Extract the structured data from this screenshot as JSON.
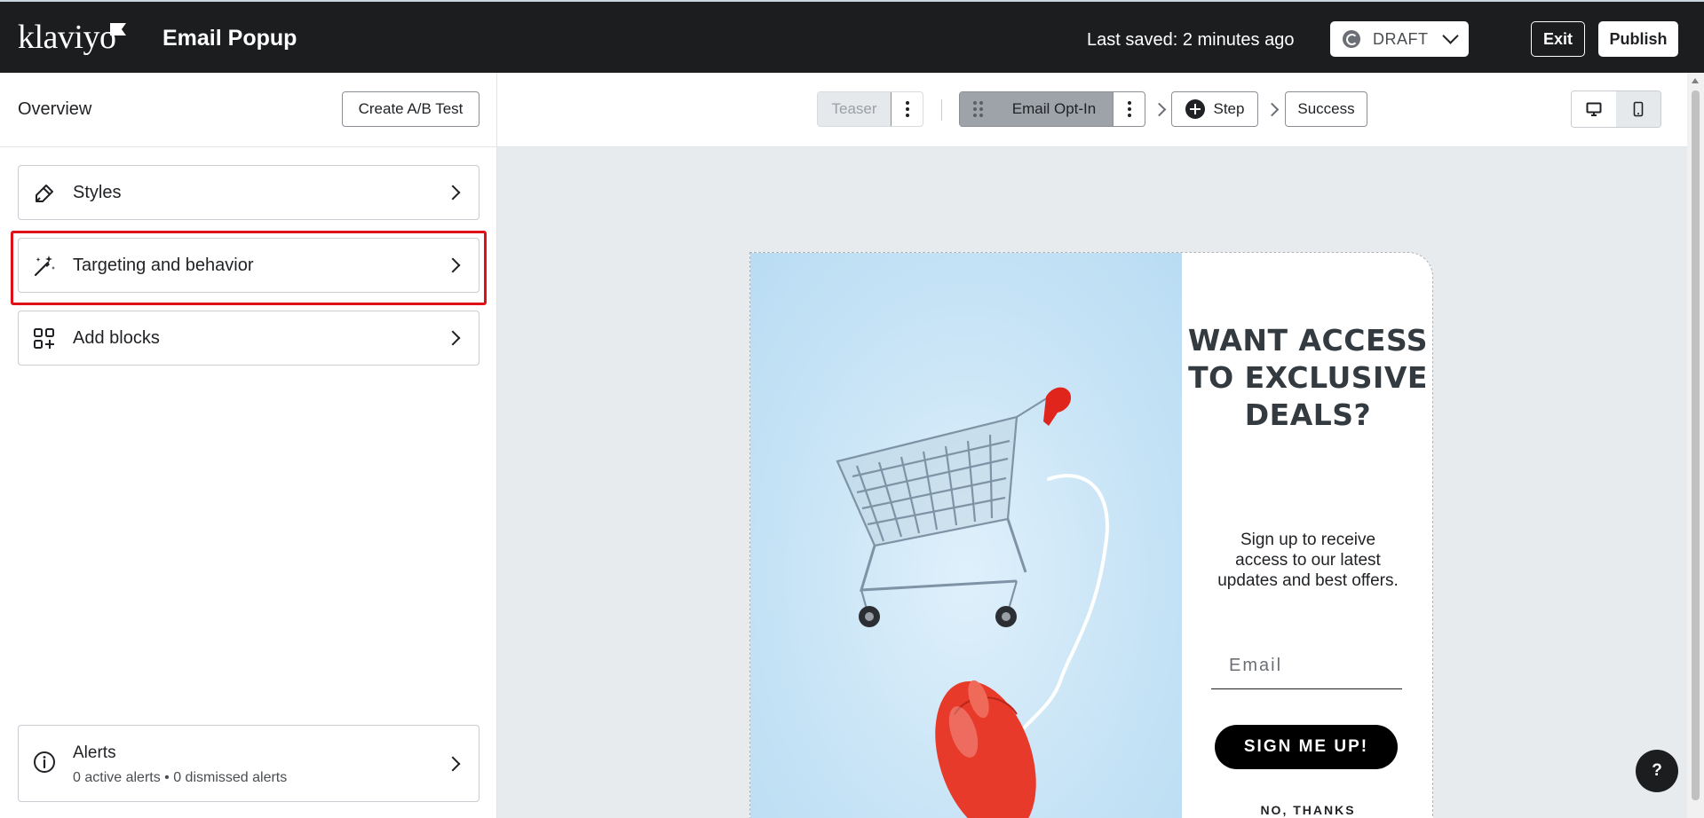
{
  "header": {
    "logo_text": "klaviyo",
    "title": "Email Popup",
    "last_saved": "Last saved: 2 minutes ago",
    "status_select": "DRAFT",
    "exit_label": "Exit",
    "publish_label": "Publish"
  },
  "sidebar": {
    "title": "Overview",
    "ab_test_label": "Create A/B Test",
    "items": [
      {
        "label": "Styles",
        "icon": "paintbrush-icon"
      },
      {
        "label": "Targeting and behavior",
        "icon": "magic-wand-icon",
        "highlighted": true
      },
      {
        "label": "Add blocks",
        "icon": "add-blocks-icon"
      }
    ],
    "alerts": {
      "title": "Alerts",
      "subtitle": "0 active alerts • 0 dismissed alerts"
    }
  },
  "steps": {
    "teaser": "Teaser",
    "optin": "Email Opt-In",
    "add_step": "Step",
    "success": "Success"
  },
  "popup": {
    "headline": "WANT ACCESS TO EXCLUSIVE DEALS?",
    "subtext": "Sign up to receive access to our latest updates and best offers.",
    "email_placeholder": "Email",
    "signup_label": "SIGN ME UP!",
    "no_thanks_label": "NO, THANKS"
  },
  "help_label": "?",
  "colors": {
    "topbar": "#1c1d1f",
    "highlight": "#e0101a",
    "canvas": "#e8ebee",
    "image_bg": "#c8e4f6",
    "cart_handle": "#e0261c",
    "mouse": "#e83a2a"
  }
}
